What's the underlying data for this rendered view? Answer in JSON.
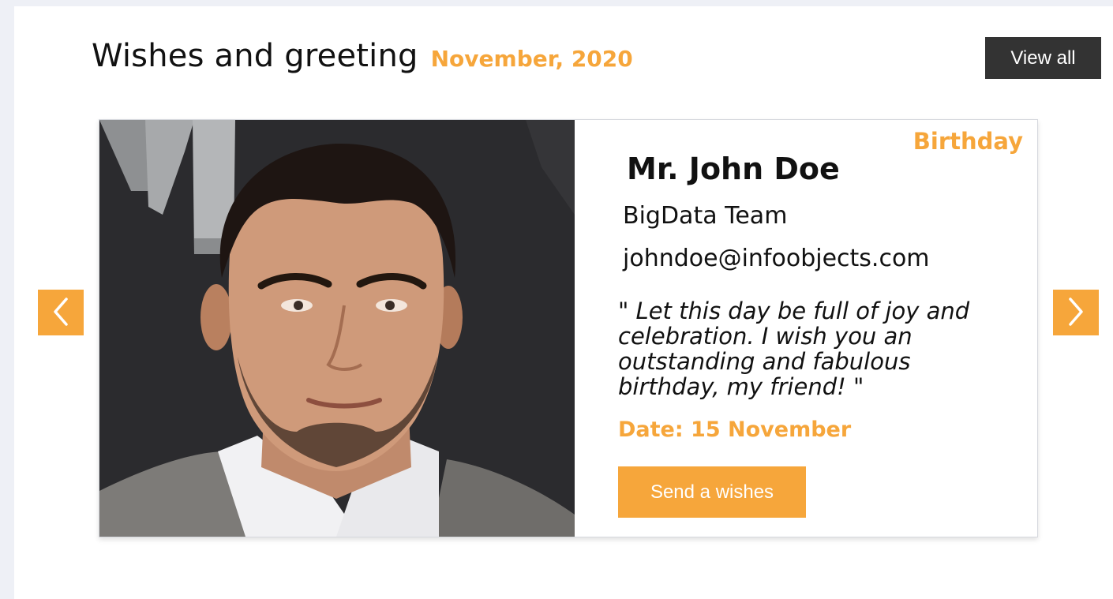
{
  "header": {
    "title": "Wishes and greeting",
    "month": "November, 2020",
    "view_all_label": "View all"
  },
  "card": {
    "category": "Birthday",
    "name": "Mr. John Doe",
    "team": "BigData Team",
    "email": "johndoe@infoobjects.com",
    "message": "\" Let this day be full of joy and celebration. I wish you an outstanding and fabulous birthday, my friend! \"",
    "date": "Date: 15 November",
    "send_label": "Send a wishes",
    "photo_alt": "avatar photo"
  },
  "carousel": {
    "prev_icon": "chevron-left-icon",
    "next_icon": "chevron-right-icon"
  },
  "colors": {
    "accent": "#f6a63b",
    "dark_button": "#333333",
    "page_background": "#eef0f6"
  }
}
